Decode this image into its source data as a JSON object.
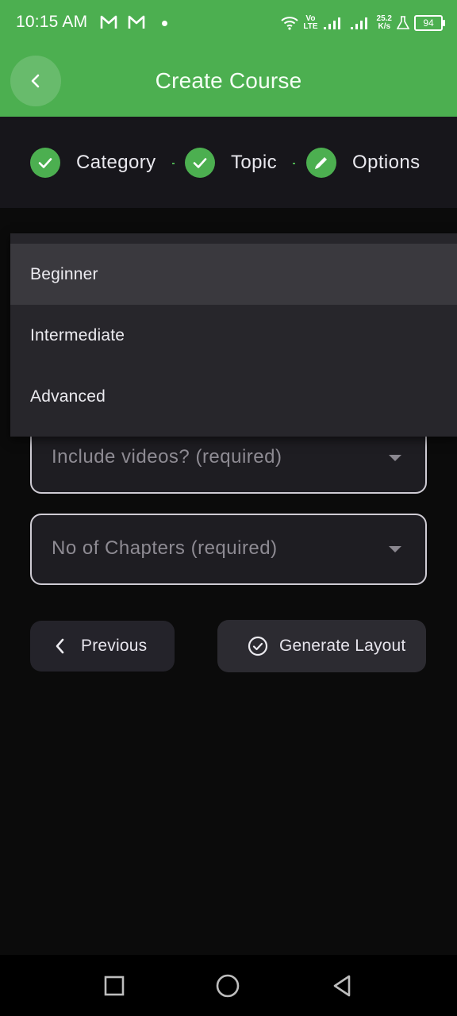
{
  "status_bar": {
    "time": "10:15 AM",
    "network_top": "Vo",
    "network_bottom": "LTE",
    "speed_top": "25.2",
    "speed_bottom": "K/s",
    "battery": "94"
  },
  "app_bar": {
    "title": "Create Course",
    "back_icon": "chevron-left-icon"
  },
  "stepper": {
    "steps": [
      {
        "label": "Category",
        "icon": "check-icon",
        "state": "complete"
      },
      {
        "label": "Topic",
        "icon": "check-icon",
        "state": "complete"
      },
      {
        "label": "Options",
        "icon": "pencil-icon",
        "state": "active"
      }
    ]
  },
  "difficulty_menu": {
    "options": [
      "Beginner",
      "Intermediate",
      "Advanced"
    ],
    "highlighted": "Beginner"
  },
  "form": {
    "include_videos": {
      "placeholder": "Include videos? (required)"
    },
    "chapters": {
      "placeholder": "No of Chapters (required)"
    }
  },
  "actions": {
    "previous_label": "Previous",
    "generate_label": "Generate Layout"
  },
  "colors": {
    "accent": "#4caf50",
    "background": "#0b0b0b",
    "surface": "#1e1d22"
  }
}
